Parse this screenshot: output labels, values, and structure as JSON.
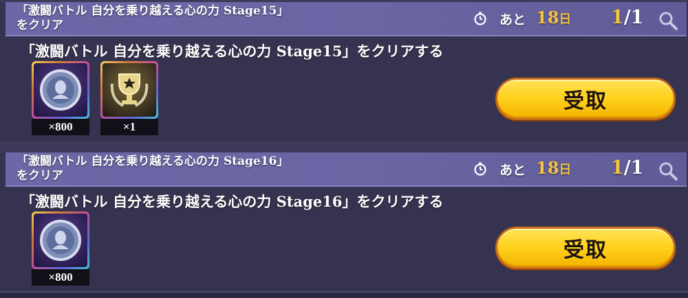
{
  "missions": [
    {
      "title": "「激闘バトル 自分を乗り越える心の力 Stage15」\nをクリア",
      "remaining_label": "あと",
      "remaining_days": "18",
      "remaining_unit": "日",
      "progress_current": "1",
      "progress_separator": "/",
      "progress_total": "1",
      "description": "「激闘バトル 自分を乗り越える心の力 Stage15」をクリアする",
      "rewards": [
        {
          "icon": "character-medal-icon",
          "quantity": "×800"
        },
        {
          "icon": "trophy-icon",
          "quantity": "×1"
        }
      ],
      "claim_label": "受取"
    },
    {
      "title": "「激闘バトル 自分を乗り越える心の力 Stage16」\nをクリア",
      "remaining_label": "あと",
      "remaining_days": "18",
      "remaining_unit": "日",
      "progress_current": "1",
      "progress_separator": "/",
      "progress_total": "1",
      "description": "「激闘バトル 自分を乗り越える心の力 Stage16」をクリアする",
      "rewards": [
        {
          "icon": "character-medal-icon",
          "quantity": "×800"
        }
      ],
      "claim_label": "受取"
    }
  ],
  "colors": {
    "accent_gold": "#f4c541",
    "header_purple": "#6a65a3",
    "panel_bg": "#35334f",
    "claim_button": "#ffd21e"
  }
}
